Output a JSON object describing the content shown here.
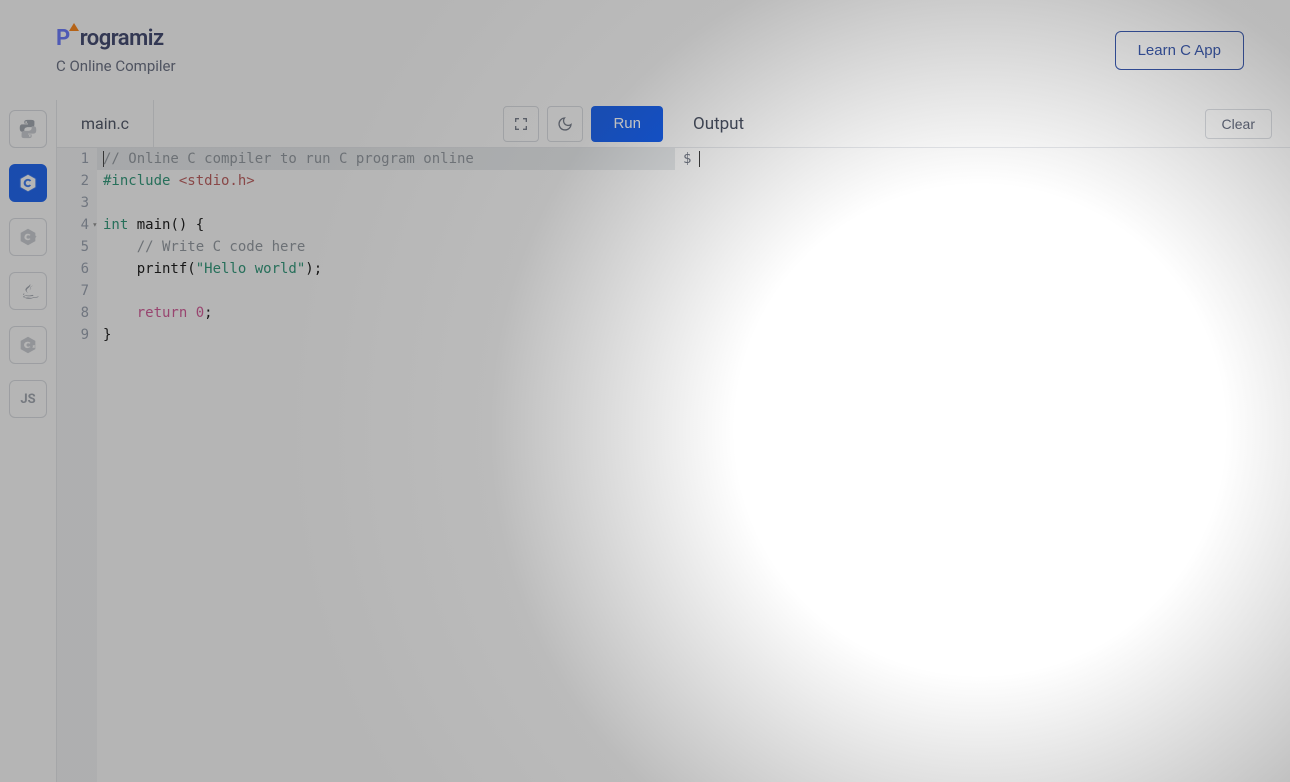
{
  "header": {
    "brand_prefix": "P",
    "brand_rest": "rogramiz",
    "subtitle": "C Online Compiler",
    "learn_button": "Learn C App"
  },
  "sidebar": {
    "languages": [
      "python",
      "c",
      "cpp",
      "java",
      "csharp",
      "js"
    ],
    "active": "c"
  },
  "editor": {
    "tab": "main.c",
    "run": "Run",
    "lines": [
      {
        "n": "1",
        "hl": true,
        "tokens": [
          {
            "cls": "tok-comment",
            "t": "// Online C compiler to run C program online"
          }
        ]
      },
      {
        "n": "2",
        "tokens": [
          {
            "cls": "tok-prep",
            "t": "#include "
          },
          {
            "cls": "tok-inc",
            "t": "<stdio.h>"
          }
        ]
      },
      {
        "n": "3",
        "tokens": []
      },
      {
        "n": "4",
        "fold": true,
        "tokens": [
          {
            "cls": "tok-kw",
            "t": "int"
          },
          {
            "cls": "",
            "t": " main() {"
          }
        ]
      },
      {
        "n": "5",
        "tokens": [
          {
            "cls": "",
            "t": "    "
          },
          {
            "cls": "tok-comment",
            "t": "// Write C code here"
          }
        ]
      },
      {
        "n": "6",
        "tokens": [
          {
            "cls": "",
            "t": "    printf("
          },
          {
            "cls": "tok-str",
            "t": "\"Hello world\""
          },
          {
            "cls": "",
            "t": ");"
          }
        ]
      },
      {
        "n": "7",
        "tokens": []
      },
      {
        "n": "8",
        "tokens": [
          {
            "cls": "",
            "t": "    "
          },
          {
            "cls": "tok-ret",
            "t": "return"
          },
          {
            "cls": "",
            "t": " "
          },
          {
            "cls": "tok-num",
            "t": "0"
          },
          {
            "cls": "",
            "t": ";"
          }
        ]
      },
      {
        "n": "9",
        "tokens": [
          {
            "cls": "",
            "t": "}"
          }
        ]
      }
    ]
  },
  "output": {
    "title": "Output",
    "clear": "Clear",
    "prompt": "$"
  }
}
